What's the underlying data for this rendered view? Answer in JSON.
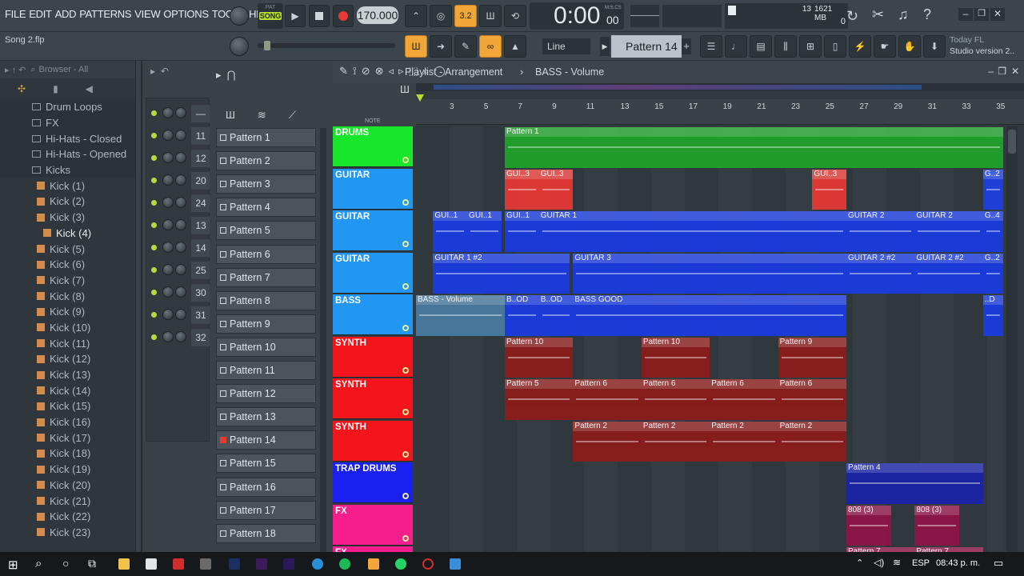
{
  "menu": [
    "FILE",
    "EDIT",
    "ADD",
    "PATTERNS",
    "VIEW",
    "OPTIONS",
    "TOOLS",
    "HELP"
  ],
  "transport": {
    "pat_label": "PAT",
    "song_label": "SONG",
    "tempo": "170.000",
    "time": "0:00",
    "time_small": "00",
    "time_unit": "M:S:CS",
    "cpu_value": "13",
    "mem": "1621 MB",
    "mem_sub": "0"
  },
  "file_name": "Song 2.flp",
  "snap": "Line",
  "pattern_selector": "Pattern 14",
  "version_hint": {
    "line1": "Today  FL",
    "line2": "Studio version 2.."
  },
  "browser": {
    "title": "Browser - All",
    "items": [
      {
        "label": "Drum Loops",
        "type": "folder"
      },
      {
        "label": "FX",
        "type": "folder"
      },
      {
        "label": "Hi-Hats - Closed",
        "type": "folder"
      },
      {
        "label": "Hi-Hats - Opened",
        "type": "folder"
      },
      {
        "label": "Kicks",
        "type": "folder"
      },
      {
        "label": "Kick (1)",
        "type": "file"
      },
      {
        "label": "Kick (2)",
        "type": "file"
      },
      {
        "label": "Kick (3)",
        "type": "file"
      },
      {
        "label": "Kick (4)",
        "type": "file-selected"
      },
      {
        "label": "Kick (5)",
        "type": "file"
      },
      {
        "label": "Kick (6)",
        "type": "file"
      },
      {
        "label": "Kick (7)",
        "type": "file"
      },
      {
        "label": "Kick (8)",
        "type": "file"
      },
      {
        "label": "Kick (9)",
        "type": "file"
      },
      {
        "label": "Kick (10)",
        "type": "file"
      },
      {
        "label": "Kick (11)",
        "type": "file"
      },
      {
        "label": "Kick (12)",
        "type": "file"
      },
      {
        "label": "Kick (13)",
        "type": "file"
      },
      {
        "label": "Kick (14)",
        "type": "file"
      },
      {
        "label": "Kick (15)",
        "type": "file"
      },
      {
        "label": "Kick (16)",
        "type": "file"
      },
      {
        "label": "Kick (17)",
        "type": "file"
      },
      {
        "label": "Kick (18)",
        "type": "file"
      },
      {
        "label": "Kick (19)",
        "type": "file"
      },
      {
        "label": "Kick (20)",
        "type": "file"
      },
      {
        "label": "Kick (21)",
        "type": "file"
      },
      {
        "label": "Kick (22)",
        "type": "file"
      },
      {
        "label": "Kick (23)",
        "type": "file"
      }
    ]
  },
  "rack_numbers": [
    "—",
    "11",
    "12",
    "20",
    "24",
    "13",
    "14",
    "25",
    "30",
    "31",
    "32"
  ],
  "patterns": [
    "Pattern 1",
    "Pattern 2",
    "Pattern 3",
    "Pattern 4",
    "Pattern 5",
    "Pattern 6",
    "Pattern 7",
    "Pattern 8",
    "Pattern 9",
    "Pattern 10",
    "Pattern 11",
    "Pattern 12",
    "Pattern 13",
    "Pattern 14",
    "Pattern 15",
    "Pattern 16",
    "Pattern 17",
    "Pattern 18"
  ],
  "playlist": {
    "title": "Playlist - Arrangement",
    "sub": "BASS - Volume",
    "ruler": [
      "3",
      "5",
      "7",
      "9",
      "11",
      "13",
      "15",
      "17",
      "19",
      "21",
      "23",
      "25",
      "27",
      "29",
      "31",
      "33",
      "35"
    ],
    "tracks": [
      {
        "name": "DRUMS",
        "color": "#18e62a"
      },
      {
        "name": "GUITAR",
        "color": "#2196f3"
      },
      {
        "name": "GUITAR",
        "color": "#2196f3"
      },
      {
        "name": "GUITAR",
        "color": "#2196f3"
      },
      {
        "name": "BASS",
        "color": "#2196f3"
      },
      {
        "name": "SYNTH",
        "color": "#f3141c"
      },
      {
        "name": "SYNTH",
        "color": "#f3141c"
      },
      {
        "name": "SYNTH",
        "color": "#f3141c"
      },
      {
        "name": "TRAP DRUMS",
        "color": "#1a20f0"
      },
      {
        "name": "FX",
        "color": "#f51e8c"
      },
      {
        "name": "FX",
        "color": "#f51e8c"
      }
    ],
    "clips": [
      {
        "row": 0,
        "start": 2.6,
        "len": 15,
        "label": "Pattern 1",
        "color": "#1fa22a"
      },
      {
        "row": 1,
        "start": 2.6,
        "len": 1,
        "label": "GUI..3",
        "color": "#e53935"
      },
      {
        "row": 1,
        "start": 3.6,
        "len": 1,
        "label": "GUI..3",
        "color": "#e53935"
      },
      {
        "row": 1,
        "start": 11.6,
        "len": 1,
        "label": "GUI..3",
        "color": "#e53935"
      },
      {
        "row": 1,
        "start": 16.6,
        "len": 0.8,
        "label": "G..2",
        "color": "#1e40e0"
      },
      {
        "row": 2,
        "start": 0.5,
        "len": 1,
        "label": "GUI..1",
        "color": "#1a3be0"
      },
      {
        "row": 2,
        "start": 1.5,
        "len": 1,
        "label": "GUI..1",
        "color": "#1a3be0"
      },
      {
        "row": 2,
        "start": 2.6,
        "len": 1,
        "label": "GUI..1",
        "color": "#1a3be0"
      },
      {
        "row": 2,
        "start": 3.6,
        "len": 9,
        "label": "GUITAR 1",
        "color": "#1a3be0"
      },
      {
        "row": 2,
        "start": 12.6,
        "len": 2,
        "label": "GUITAR 2",
        "color": "#1a3be0"
      },
      {
        "row": 2,
        "start": 14.6,
        "len": 2,
        "label": "GUITAR 2",
        "color": "#1a3be0"
      },
      {
        "row": 2,
        "start": 16.6,
        "len": 0.8,
        "label": "G..4",
        "color": "#1a3be0"
      },
      {
        "row": 3,
        "start": 0.5,
        "len": 4,
        "label": "GUITAR 1 #2",
        "color": "#1a3be0"
      },
      {
        "row": 3,
        "start": 4.6,
        "len": 8,
        "label": "GUITAR 3",
        "color": "#1a3be0"
      },
      {
        "row": 3,
        "start": 12.6,
        "len": 2,
        "label": "GUITAR 2 #2",
        "color": "#1a3be0"
      },
      {
        "row": 3,
        "start": 14.6,
        "len": 2,
        "label": "GUITAR 2 #2",
        "color": "#1a3be0"
      },
      {
        "row": 3,
        "start": 16.6,
        "len": 0.8,
        "label": "G..2",
        "color": "#1a3be0"
      },
      {
        "row": 4,
        "start": 0,
        "len": 2.6,
        "label": "BASS - Volume",
        "color": "#4a7aa0"
      },
      {
        "row": 4,
        "start": 2.6,
        "len": 1,
        "label": "B..OD",
        "color": "#1a3be0"
      },
      {
        "row": 4,
        "start": 3.6,
        "len": 1,
        "label": "B..OD",
        "color": "#1a3be0"
      },
      {
        "row": 4,
        "start": 4.6,
        "len": 8,
        "label": "BASS GOOD",
        "color": "#1a3be0"
      },
      {
        "row": 4,
        "start": 16.6,
        "len": 0.8,
        "label": "..D",
        "color": "#1a3be0"
      },
      {
        "row": 5,
        "start": 2.6,
        "len": 2,
        "label": "Pattern 10",
        "color": "#8b1c1c"
      },
      {
        "row": 5,
        "start": 6.6,
        "len": 2,
        "label": "Pattern 10",
        "color": "#8b1c1c"
      },
      {
        "row": 5,
        "start": 10.6,
        "len": 2,
        "label": "Pattern 9",
        "color": "#8b1c1c"
      },
      {
        "row": 6,
        "start": 2.6,
        "len": 2,
        "label": "Pattern 5",
        "color": "#8b1c1c"
      },
      {
        "row": 6,
        "start": 4.6,
        "len": 2,
        "label": "Pattern 6",
        "color": "#8b1c1c"
      },
      {
        "row": 6,
        "start": 6.6,
        "len": 2,
        "label": "Pattern 6",
        "color": "#8b1c1c"
      },
      {
        "row": 6,
        "start": 8.6,
        "len": 2,
        "label": "Pattern 6",
        "color": "#8b1c1c"
      },
      {
        "row": 6,
        "start": 10.6,
        "len": 2,
        "label": "Pattern 6",
        "color": "#8b1c1c"
      },
      {
        "row": 7,
        "start": 4.6,
        "len": 2,
        "label": "Pattern 2",
        "color": "#8b1c1c"
      },
      {
        "row": 7,
        "start": 6.6,
        "len": 2,
        "label": "Pattern 2",
        "color": "#8b1c1c"
      },
      {
        "row": 7,
        "start": 8.6,
        "len": 2,
        "label": "Pattern 2",
        "color": "#8b1c1c"
      },
      {
        "row": 7,
        "start": 10.6,
        "len": 2,
        "label": "Pattern 2",
        "color": "#8b1c1c"
      },
      {
        "row": 8,
        "start": 12.6,
        "len": 4,
        "label": "Pattern 4",
        "color": "#1a24a8"
      },
      {
        "row": 9,
        "start": 12.6,
        "len": 1.3,
        "label": "808 (3)",
        "color": "#8e1446"
      },
      {
        "row": 9,
        "start": 14.6,
        "len": 1.3,
        "label": "808 (3)",
        "color": "#8e1446"
      },
      {
        "row": 10,
        "start": 12.6,
        "len": 2,
        "label": "Pattern 7",
        "color": "#8e1446"
      },
      {
        "row": 10,
        "start": 14.6,
        "len": 2,
        "label": "Pattern 7",
        "color": "#8e1446"
      }
    ]
  },
  "taskbar": {
    "lang": "ESP",
    "time": "08:43 p. m."
  }
}
